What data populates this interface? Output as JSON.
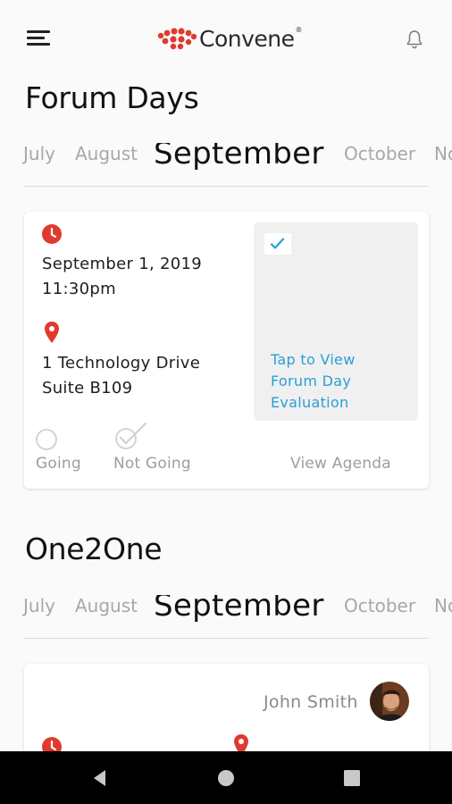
{
  "header": {
    "logo_text": "Convene",
    "logo_mark": "®",
    "menu_icon": "hamburger-menu-icon",
    "notification_icon": "bell-icon"
  },
  "forum_days": {
    "title": "Forum Days",
    "months": [
      "July",
      "August",
      "September",
      "October",
      "No"
    ],
    "active_month": "September",
    "card": {
      "date": "September 1, 2019",
      "time": "11:30pm",
      "address_line1": "1 Technology Drive",
      "address_line2": "Suite B109",
      "evaluation_lines": [
        "Tap to View",
        "Forum Day",
        "Evaluation"
      ],
      "going_label": "Going",
      "not_going_label": "Not Going",
      "view_agenda_label": "View Agenda"
    }
  },
  "one2one": {
    "title": "One2One",
    "months": [
      "July",
      "August",
      "September",
      "October",
      "No"
    ],
    "active_month": "September",
    "card": {
      "person_name": "John Smith"
    }
  },
  "colors": {
    "accent_red": "#e03a2f",
    "link_blue": "#2a9fd6",
    "muted": "#9e9e9e"
  },
  "navbar": {
    "buttons": [
      "back-icon",
      "home-icon",
      "recents-icon"
    ]
  }
}
